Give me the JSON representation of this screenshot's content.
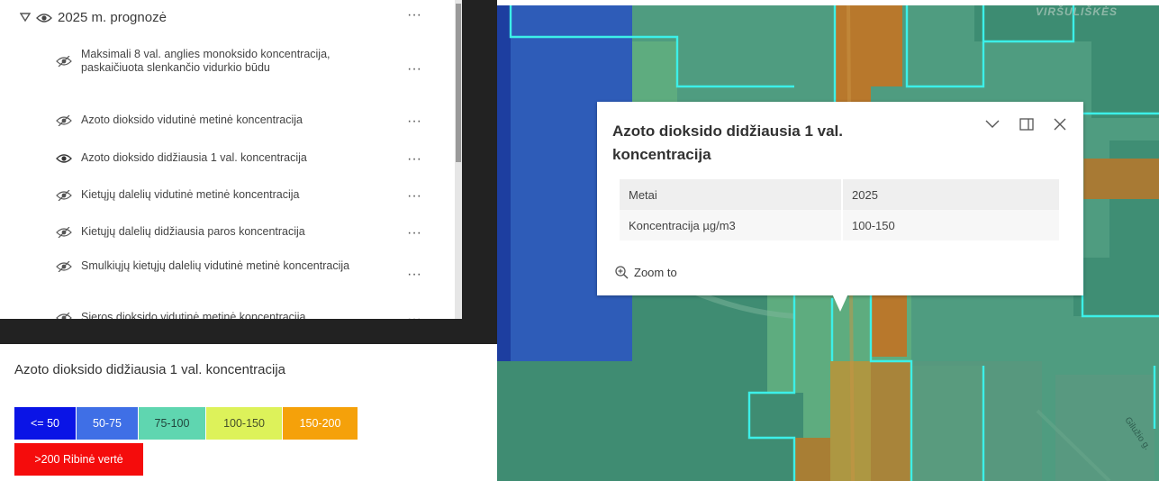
{
  "layer_list": {
    "group": {
      "label": "2025 m. prognozė",
      "expanded": true,
      "visible": true
    },
    "layers": [
      {
        "label": "Maksimali 8 val. anglies monoksido koncentracija, paskaičiuota slenkančio vidurkio būdu",
        "visible": false
      },
      {
        "label": "Azoto dioksido vidutinė metinė koncentracija",
        "visible": false
      },
      {
        "label": "Azoto dioksido didžiausia 1 val. koncentracija",
        "visible": true
      },
      {
        "label": "Kietųjų dalelių vidutinė metinė koncentracija",
        "visible": false
      },
      {
        "label": "Kietųjų dalelių didžiausia paros koncentracija",
        "visible": false
      },
      {
        "label": "Smulkiųjų kietųjų dalelių vidutinė metinė koncentracija",
        "visible": false
      },
      {
        "label": "Sieros dioksido vidutinė metinė koncentracija",
        "visible": false
      }
    ],
    "options_icon": "ellipsis-icon"
  },
  "legend": {
    "title": "Azoto dioksido didžiausia 1 val. koncentracija",
    "classes": [
      {
        "label": "<= 50",
        "color": "#0a14e6"
      },
      {
        "label": "50-75",
        "color": "#3f6fe6"
      },
      {
        "label": "75-100",
        "color": "#5fd6b0"
      },
      {
        "label": "100-150",
        "color": "#ddf25a"
      },
      {
        "label": "150-200",
        "color": "#f5a10a"
      },
      {
        "label": ">200 Ribinė vertė",
        "color": "#f50c0c"
      }
    ]
  },
  "map": {
    "place_label": "VIRŠULIŠKĖS",
    "street_label": "Gilužio g."
  },
  "popup": {
    "title": "Azoto dioksido didžiausia 1 val. koncentracija",
    "fields": [
      {
        "key": "Metai",
        "value": "2025"
      },
      {
        "key": "Koncentracija µg/m3",
        "value": "100-150"
      }
    ],
    "zoom_label": "Zoom to",
    "icons": [
      "chevron-down-icon",
      "dock-icon",
      "close-icon"
    ]
  }
}
